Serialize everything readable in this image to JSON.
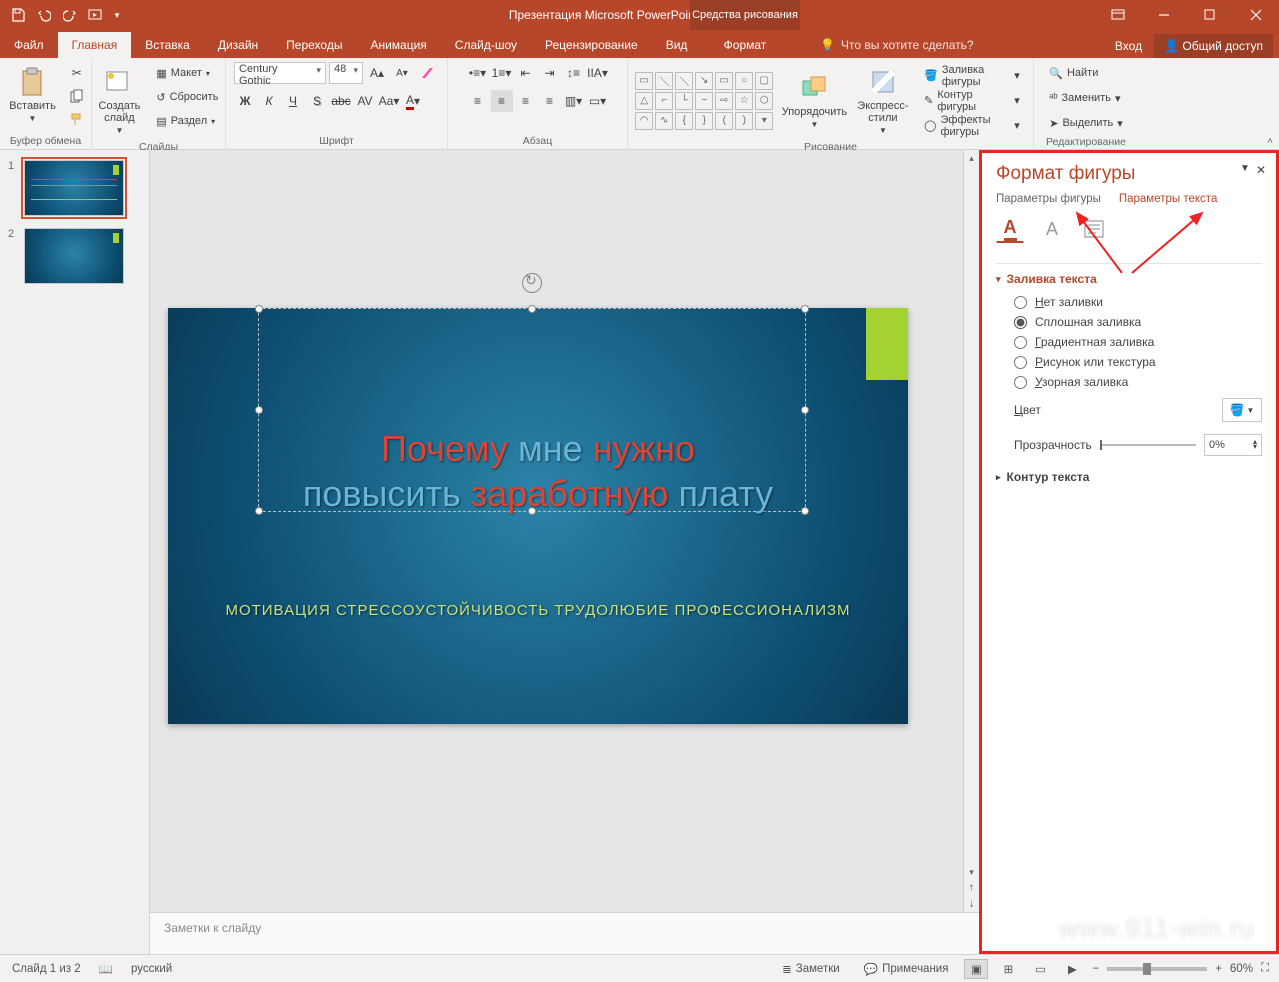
{
  "titlebar": {
    "title": "Презентация Microsoft PowerPoint - PowerPoint",
    "drawing_tools": "Средства рисования"
  },
  "tabs": {
    "file": "Файл",
    "home": "Главная",
    "insert": "Вставка",
    "design": "Дизайн",
    "transitions": "Переходы",
    "animation": "Анимация",
    "slideshow": "Слайд-шоу",
    "review": "Рецензирование",
    "view": "Вид",
    "format": "Формат",
    "tellme": "Что вы хотите сделать?",
    "signin": "Вход",
    "share": "Общий доступ"
  },
  "ribbon": {
    "clipboard": {
      "paste": "Вставить",
      "label": "Буфер обмена"
    },
    "slides": {
      "new_slide": "Создать\nслайд",
      "layout": "Макет",
      "reset": "Сбросить",
      "section": "Раздел",
      "label": "Слайды"
    },
    "font": {
      "name": "Century Gothic",
      "size": "48",
      "label": "Шрифт"
    },
    "paragraph": {
      "label": "Абзац"
    },
    "drawing": {
      "arrange": "Упорядочить",
      "quickstyles": "Экспресс-\nстили",
      "fill": "Заливка фигуры",
      "outline": "Контур фигуры",
      "effects": "Эффекты фигуры",
      "label": "Рисование"
    },
    "editing": {
      "find": "Найти",
      "replace": "Заменить",
      "select": "Выделить",
      "label": "Редактирование"
    }
  },
  "slidepane": {
    "n1": "1",
    "n2": "2"
  },
  "slide": {
    "title_w1": "Почему",
    "title_w2": "мне",
    "title_w3": "нужно",
    "title_w4": "повысить",
    "title_w5": "заработную",
    "title_w6": "плату",
    "subtitle": "МОТИВАЦИЯ СТРЕССОУСТОЙЧИВОСТЬ ТРУДОЛЮБИЕ ПРОФЕССИОНАЛИЗМ"
  },
  "notes": {
    "placeholder": "Заметки к слайду"
  },
  "formatpane": {
    "title": "Формат фигуры",
    "tab_shape": "Параметры фигуры",
    "tab_text": "Параметры текста",
    "sec_fill": "Заливка текста",
    "r_none": "Нет заливки",
    "r_solid": "Сплошная заливка",
    "r_gradient": "Градиентная заливка",
    "r_picture": "Рисунок или текстура",
    "r_pattern": "Узорная заливка",
    "color": "Цвет",
    "transparency": "Прозрачность",
    "transparency_val": "0%",
    "sec_outline": "Контур текста"
  },
  "statusbar": {
    "slide": "Слайд 1 из 2",
    "lang": "русский",
    "notes": "Заметки",
    "comments": "Примечания",
    "zoom": "60%"
  },
  "watermark": "www.911-win.ru"
}
